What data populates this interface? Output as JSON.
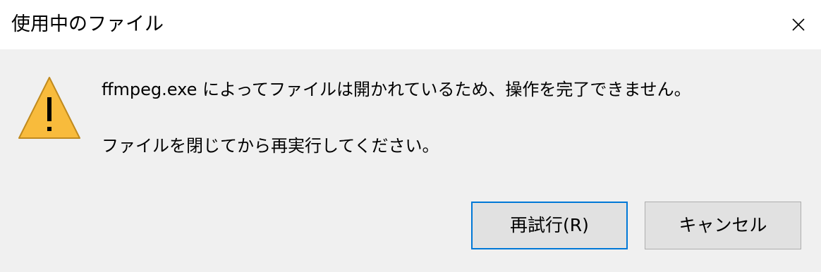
{
  "window": {
    "title": "使用中のファイル",
    "close_icon": "close-icon"
  },
  "message": {
    "icon": "warning-icon",
    "icon_color": "#f8bb3c",
    "line1": "ffmpeg.exe によってファイルは開かれているため、操作を完了できません。",
    "line2": "ファイルを閉じてから再実行してください。"
  },
  "buttons": {
    "retry_label": "再試行(R)",
    "cancel_label": "キャンセル",
    "focus_color": "#0078d7"
  }
}
